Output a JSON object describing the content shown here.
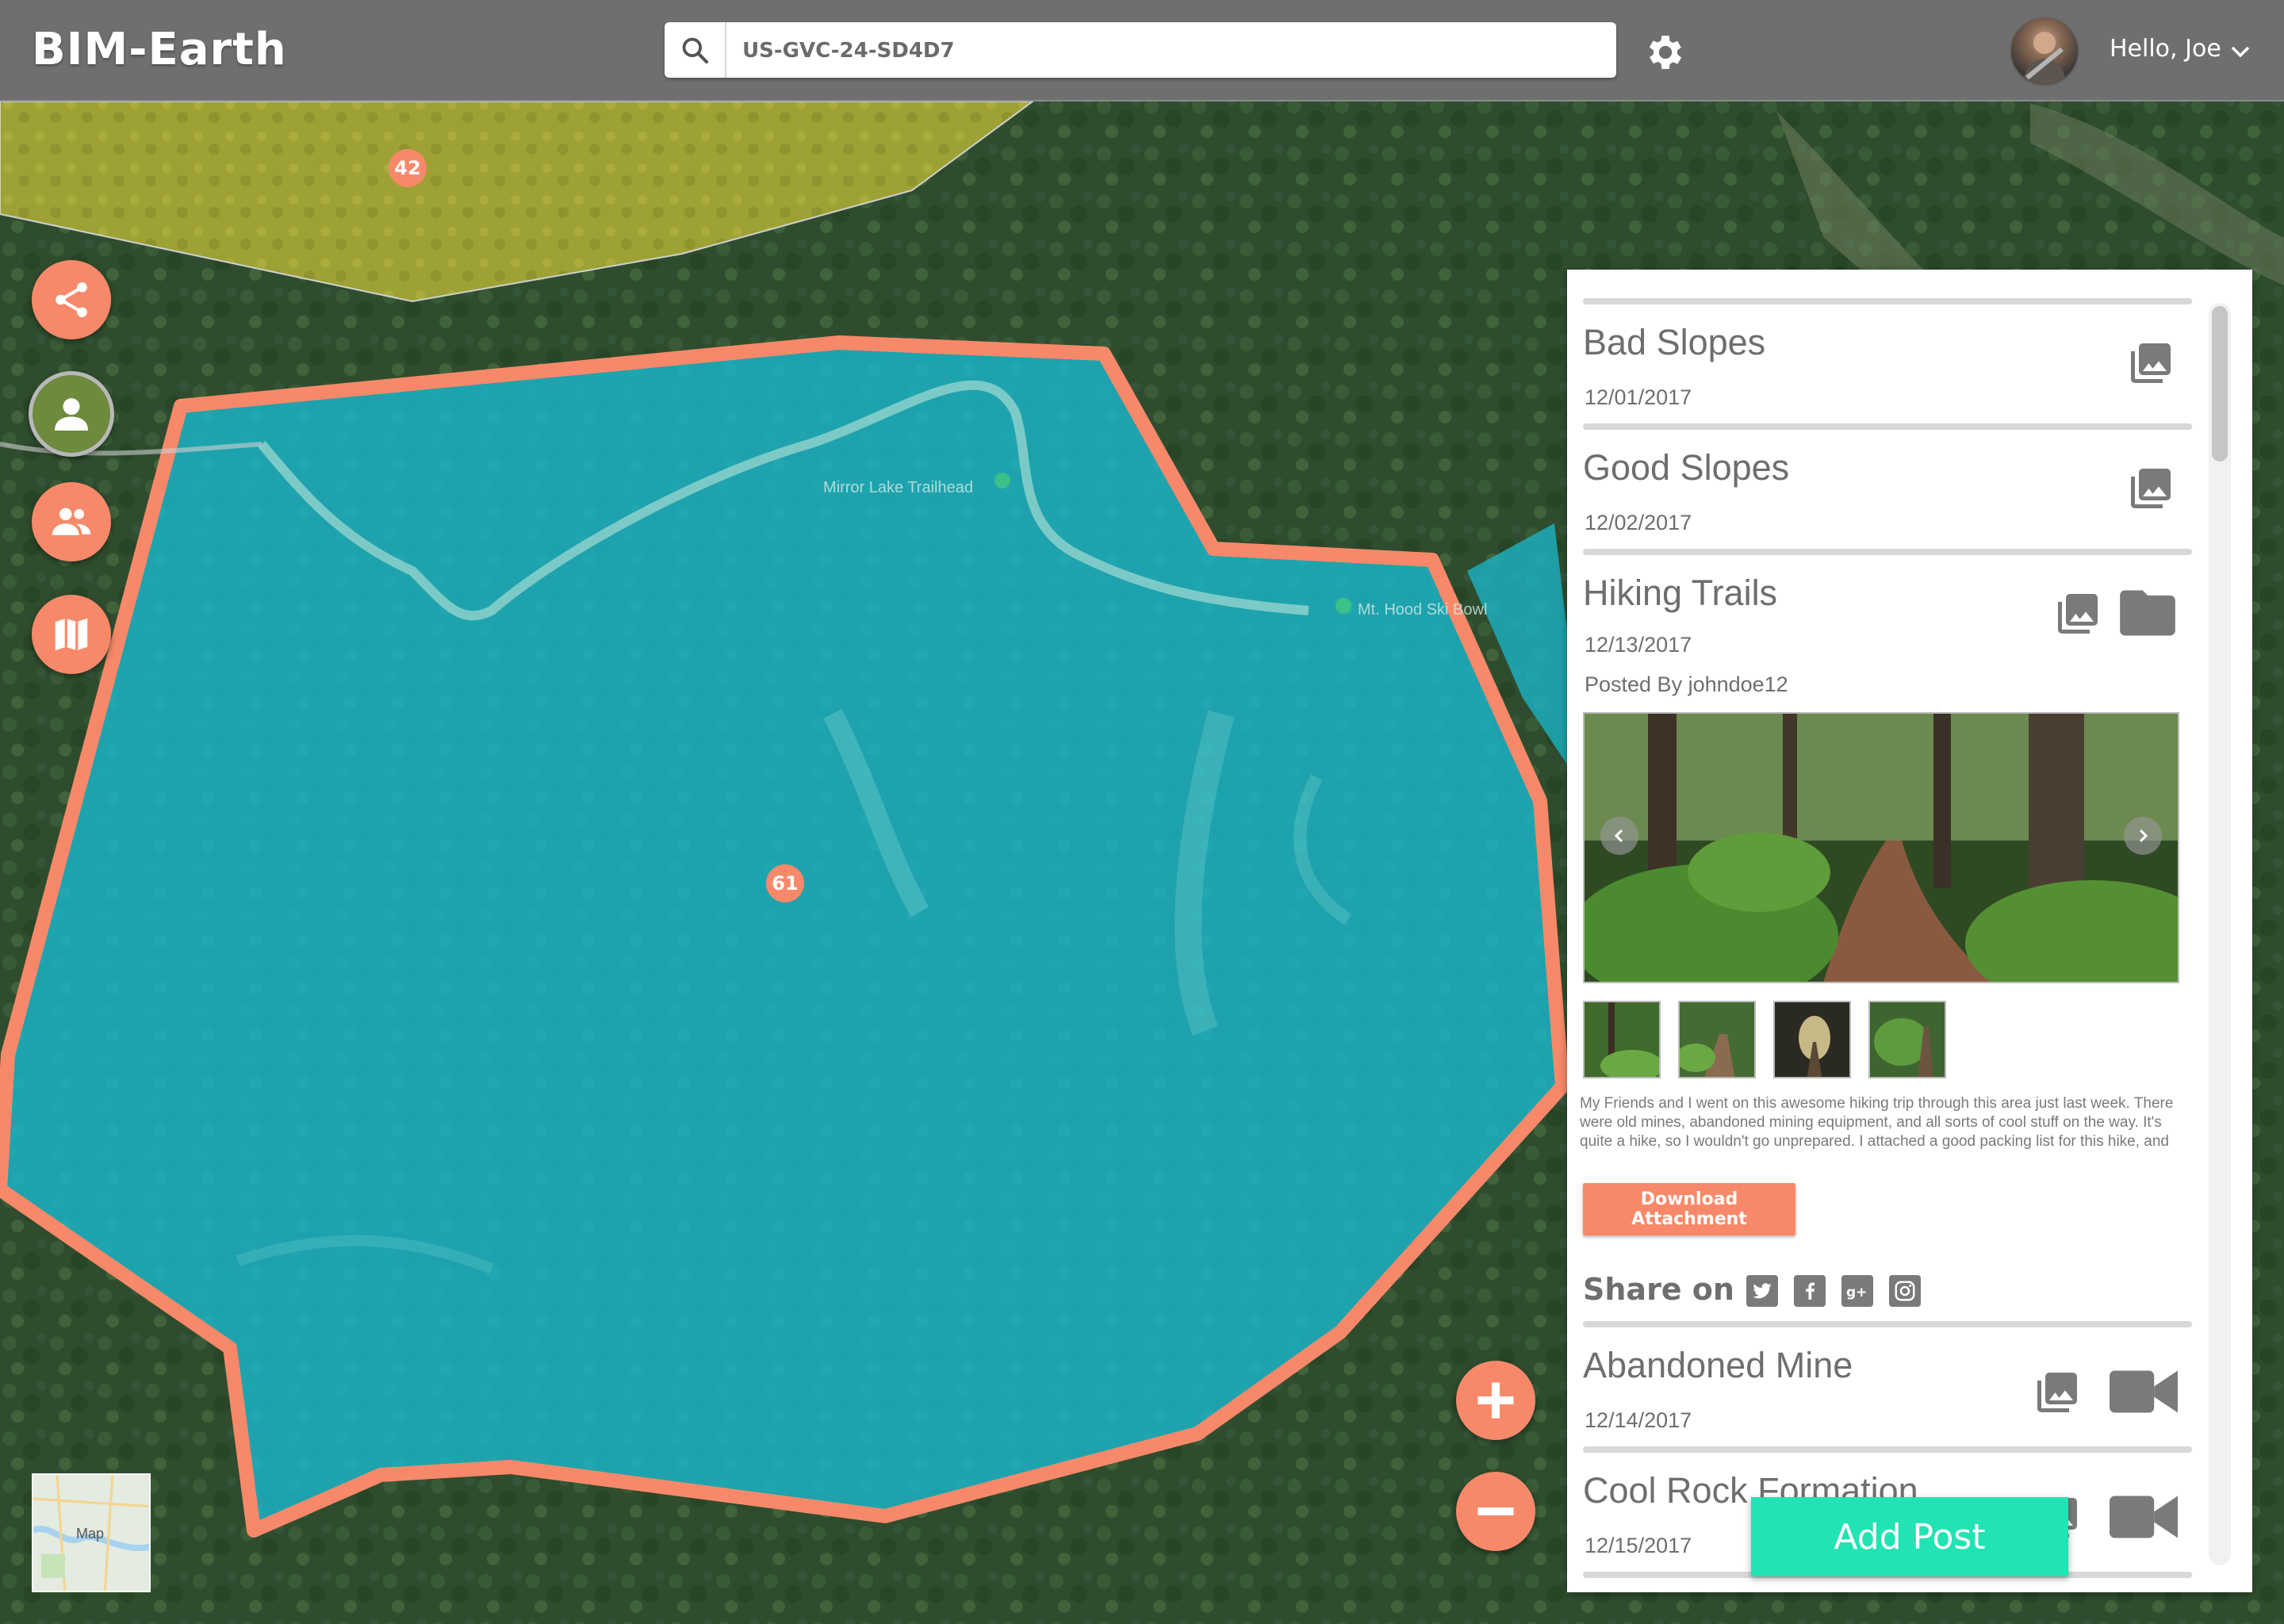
{
  "app": {
    "brand": "BIM-Earth"
  },
  "search": {
    "value": "US-GVC-24-SD4D7"
  },
  "user": {
    "greeting": "Hello, Joe"
  },
  "map": {
    "clusters": [
      {
        "count": "42"
      },
      {
        "count": "61"
      }
    ],
    "labels": {
      "trailhead": "Mirror Lake Trailhead",
      "school": "Mt. Hood Ski Bowl"
    },
    "minimap_label": "Map"
  },
  "colors": {
    "accent": "#f7896a",
    "polygon_fill": "#1bb3c4",
    "yellow_area": "#a4a634",
    "add_post": "#21e3b4"
  },
  "panel": {
    "posts": [
      {
        "title": "Bad Slopes",
        "date": "12/01/2017",
        "icons": [
          "photo-library-icon"
        ]
      },
      {
        "title": "Good Slopes",
        "date": "12/02/2017",
        "icons": [
          "photo-library-icon"
        ]
      },
      {
        "title": "Hiking Trails",
        "date": "12/13/2017",
        "icons": [
          "photo-library-icon",
          "folder-icon"
        ],
        "posted_by": "Posted By johndoe12",
        "description": "My Friends and I went on this awesome hiking trip through this area just last week. There were old mines, abandoned mining equipment, and all sorts of cool stuff on the way. It's quite a hike, so I wouldn't go unprepared. I attached a good packing list for this hike, and all of the photos I took while on the hike.",
        "download_label": "Download Attachment",
        "share_label": "Share on :",
        "share_networks": [
          "twitter-icon",
          "facebook-icon",
          "google-plus-icon",
          "instagram-icon"
        ]
      },
      {
        "title": "Abandoned Mine",
        "date": "12/14/2017",
        "icons": [
          "photo-library-icon",
          "video-camera-icon"
        ]
      },
      {
        "title": "Cool Rock Formation",
        "date": "12/15/2017",
        "icons": [
          "photo-library-icon",
          "video-camera-icon"
        ]
      }
    ]
  },
  "add_post": {
    "label": "Add Post"
  }
}
